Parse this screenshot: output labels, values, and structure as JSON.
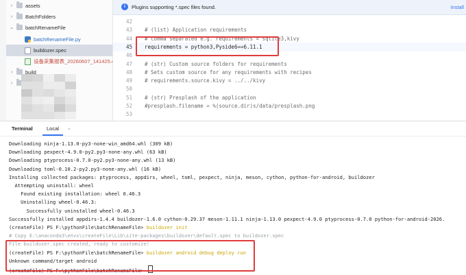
{
  "banner": {
    "text": "Plugins supporting *.spec files found.",
    "action": "Install"
  },
  "tree": [
    {
      "label": "assets",
      "type": "folder",
      "arrow": "›",
      "indent": 0
    },
    {
      "label": "BatchFolders",
      "type": "folder",
      "arrow": "›",
      "indent": 0
    },
    {
      "label": "batchRenameFile",
      "type": "folder",
      "arrow": "⌄",
      "indent": 0
    },
    {
      "label": "batchRenameFile.py",
      "type": "py",
      "arrow": "",
      "indent": 1
    },
    {
      "label": "buildozer.spec",
      "type": "spec",
      "arrow": "",
      "indent": 1,
      "selected": true
    },
    {
      "label": "设备采集报表_20260607_141425.csv",
      "type": "csv",
      "arrow": "",
      "indent": 1
    },
    {
      "label": "build",
      "type": "folder",
      "arrow": "›",
      "indent": 0
    },
    {
      "label": "dist",
      "type": "folder",
      "arrow": "›",
      "indent": 0
    }
  ],
  "editor": {
    "lines": [
      {
        "num": "42",
        "text": "",
        "kind": "code"
      },
      {
        "num": "43",
        "text": "# (list) Application requirements",
        "kind": "comment"
      },
      {
        "num": "44",
        "text": "# comma separated e.g. requirements = sqlite3,kivy",
        "kind": "comment"
      },
      {
        "num": "45",
        "text": "requirements = python3,Pyside6==6.11.1",
        "kind": "code",
        "current": true
      },
      {
        "num": "46",
        "text": "",
        "kind": "code"
      },
      {
        "num": "47",
        "text": "# (str) Custom source folders for requirements",
        "kind": "comment"
      },
      {
        "num": "48",
        "text": "# Sets custom source for any requirements with recipes",
        "kind": "comment"
      },
      {
        "num": "49",
        "text": "# requirements.source.kivy = ../../kivy",
        "kind": "comment"
      },
      {
        "num": "50",
        "text": "",
        "kind": "code"
      },
      {
        "num": "51",
        "text": "# (str) Presplash of the application",
        "kind": "comment"
      },
      {
        "num": "52",
        "text": "#presplash.filename = %(source.dir)s/data/presplash.png",
        "kind": "comment"
      },
      {
        "num": "53",
        "text": "",
        "kind": "code"
      }
    ]
  },
  "terminal": {
    "tab_title": "Terminal",
    "tab_local": "Local",
    "tab_close": "⌄",
    "lines": [
      {
        "text": "Downloading ninja-1.13.0-py3-none-win_amd64.whl (309 kB)"
      },
      {
        "text": "Downloading pexpect-4.9.0-py2.py3-none-any.whl (63 kB)"
      },
      {
        "text": "Downloading ptyprocess-0.7.0-py2.py3-none-any.whl (13 kB)"
      },
      {
        "text": "Downloading toml-0.10.2-py2.py3-none-any.whl (16 kB)"
      },
      {
        "text": "Installing collected packages: ptyprocess, appdirs, wheel, toml, pexpect, ninja, meson, cython, python-for-android, buildozer"
      },
      {
        "text": "  Attempting uninstall: wheel"
      },
      {
        "text": "    Found existing installation: wheel 0.46.3"
      },
      {
        "text": "    Uninstalling wheel-0.46.3:"
      },
      {
        "text": "      Successfully uninstalled wheel-0.46.3"
      },
      {
        "text": "Successfully installed appdirs-1.4.4 buildozer-1.6.0 cython-0.29.37 meson-1.11.1 ninja-1.13.0 pexpect-4.9.0 ptyprocess-0.7.0 python-for-android-2026."
      },
      {
        "prompt": "(createFile) PS F:\\pythonFile\\batchRenameFile> ",
        "cmd": "buildozer init"
      },
      {
        "text": "# Copy E:\\anaconda3\\envs\\createFile\\Lib\\site-packages\\buildozer\\default.spec to buildozer.spec",
        "faded": true
      },
      {
        "text": "File buildozer.spec created, ready to customize!",
        "faded": true
      },
      {
        "prompt": "(createFile) PS F:\\pythonFile\\batchRenameFile> ",
        "cmd": "buildozer android debug deploy run"
      },
      {
        "text": "Unknown command/target android"
      },
      {
        "prompt": "(createFile) PS F:\\pythonFile\\batchRenameFile> ",
        "cmd": ""
      }
    ]
  }
}
